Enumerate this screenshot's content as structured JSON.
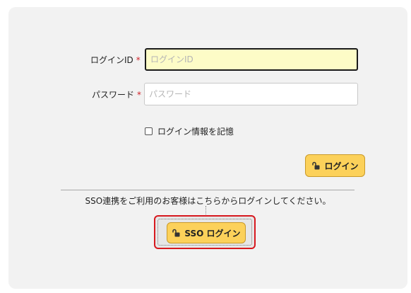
{
  "login_form": {
    "login_id": {
      "label": "ログインID",
      "required_mark": "*",
      "placeholder": "ログインID",
      "value": ""
    },
    "password": {
      "label": "パスワード",
      "required_mark": "*",
      "placeholder": "パスワード",
      "value": ""
    },
    "remember": {
      "label": "ログイン情報を記憶",
      "checked": false
    },
    "login_button": {
      "label": "ログイン",
      "icon": "unlock-icon"
    }
  },
  "sso": {
    "message": "SSO連携をご利用のお客様はこちらからログインしてください。",
    "button": {
      "label": "SSO ログイン",
      "icon": "unlock-icon"
    }
  },
  "colors": {
    "button_bg": "#fcd15a",
    "focused_input_bg": "#fdfcc7",
    "required": "#d0242a",
    "focus_ring": "#d7191f"
  }
}
